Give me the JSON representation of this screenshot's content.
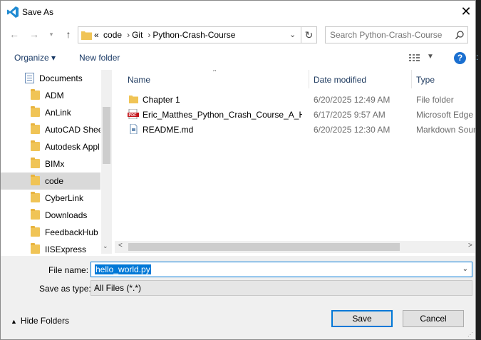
{
  "window": {
    "title": "Save As"
  },
  "nav": {
    "breadcrumbs": [
      "code",
      "Git",
      "Python-Crash-Course"
    ],
    "overflow": "«",
    "search_placeholder": "Search Python-Crash-Course"
  },
  "toolbar": {
    "organize": "Organize ▾",
    "new_folder": "New folder",
    "help": "?"
  },
  "sidebar": {
    "items": [
      {
        "label": "Documents",
        "icon": "documents-icon"
      },
      {
        "label": "ADM",
        "icon": "folder-icon"
      },
      {
        "label": "AnLink",
        "icon": "folder-icon"
      },
      {
        "label": "AutoCAD Shee",
        "icon": "folder-icon"
      },
      {
        "label": "Autodesk Appl",
        "icon": "folder-icon"
      },
      {
        "label": "BIMx",
        "icon": "folder-icon"
      },
      {
        "label": "code",
        "icon": "folder-icon",
        "selected": true
      },
      {
        "label": "CyberLink",
        "icon": "folder-icon"
      },
      {
        "label": "Downloads",
        "icon": "folder-icon"
      },
      {
        "label": "FeedbackHub",
        "icon": "folder-icon"
      },
      {
        "label": "IISExpress",
        "icon": "folder-icon"
      }
    ]
  },
  "files": {
    "columns": [
      "Name",
      "Date modified",
      "Type"
    ],
    "rows": [
      {
        "name": "Chapter 1",
        "date": "6/20/2025 12:49 AM",
        "type": "File folder",
        "icon": "folder-icon"
      },
      {
        "name": "Eric_Matthes_Python_Crash_Course_A_H...",
        "date": "6/17/2025 9:57 AM",
        "type": "Microsoft Edge P",
        "icon": "pdf-icon"
      },
      {
        "name": "README.md",
        "date": "6/20/2025 12:30 AM",
        "type": "Markdown Sour",
        "icon": "document-icon"
      }
    ]
  },
  "form": {
    "file_name_label": "File name:",
    "file_name_value": "hello_world.py",
    "save_as_type_label": "Save as type:",
    "save_as_type_value": "All Files (*.*)"
  },
  "footer": {
    "hide_folders": "Hide Folders",
    "save": "Save",
    "cancel": "Cancel"
  },
  "colors": {
    "accent": "#0078d7",
    "selected_row": "#d9d9d9",
    "help": "#1a6fd0"
  }
}
